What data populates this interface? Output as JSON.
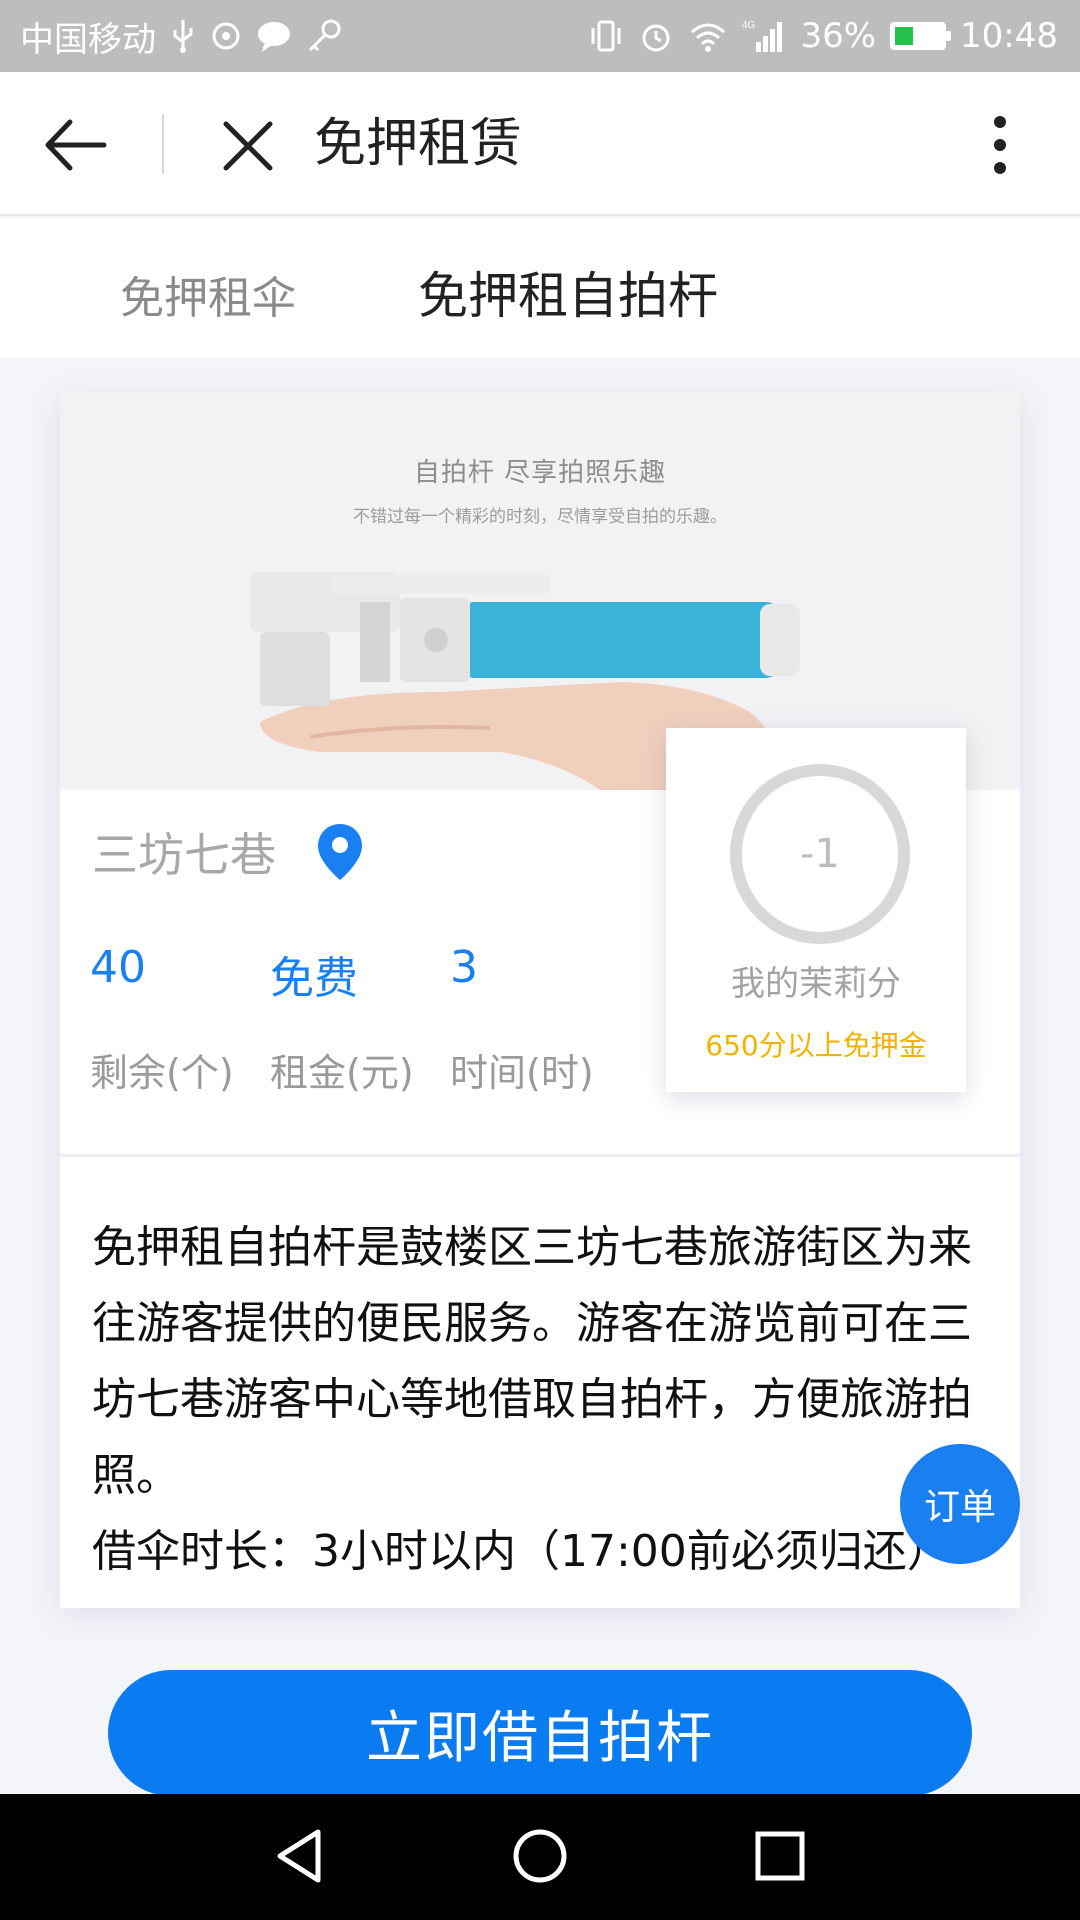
{
  "status_bar": {
    "carrier": "中国移动",
    "battery_percent": "36%",
    "time": "10:48",
    "icons": [
      "usb-icon",
      "sync-icon",
      "message-icon",
      "key-icon",
      "vibrate-icon",
      "alarm-icon",
      "wifi-icon",
      "signal-icon",
      "battery-icon"
    ]
  },
  "title_bar": {
    "title": "免押租赁"
  },
  "tabs": [
    {
      "label": "免押租伞",
      "active": false
    },
    {
      "label": "免押租自拍杆",
      "active": true
    }
  ],
  "banner": {
    "title": "自拍杆  尽享拍照乐趣",
    "subtitle": "不错过每一个精彩的时刻，尽情享受自拍的乐趣。"
  },
  "location": {
    "name": "三坊七巷",
    "icon": "location-pin-icon"
  },
  "stats": {
    "remaining_value": "40",
    "rent_value": "免费",
    "time_value": "3",
    "remaining_label": "剩余(个)",
    "rent_label": "租金(元)",
    "time_label": "时间(时)"
  },
  "score_card": {
    "score": "-1",
    "label": "我的茉莉分",
    "hint": "650分以上免押金"
  },
  "description": {
    "para1": "免押租自拍杆是鼓楼区三坊七巷旅游街区为来往游客提供的便民服务。游客在游览前可在三坊七巷游客中心等地借取自拍杆，方便旅游拍照。",
    "para2": "借伞时长：3小时以内（17:00前必须归还）"
  },
  "order_button": "订单",
  "borrow_button": "立即借自拍杆",
  "colors": {
    "accent": "#0a7bf0",
    "stat_blue": "#1a7ff0",
    "hint_yellow": "#f2b300"
  }
}
